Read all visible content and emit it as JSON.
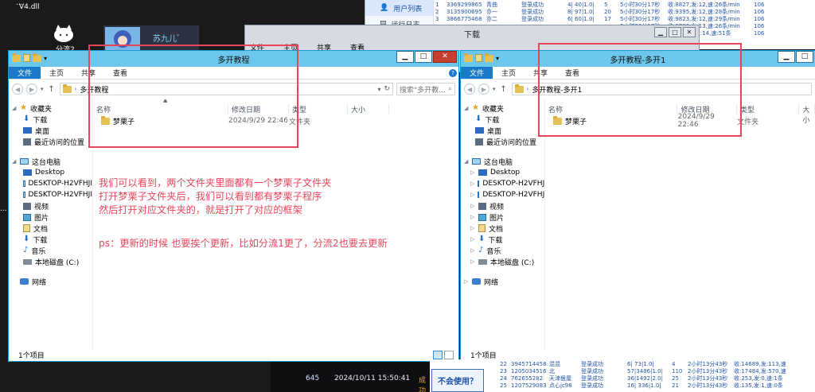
{
  "desktop": {
    "dll_label": "V4.dll",
    "top_label": "...",
    "share_label": "分流2",
    "avatar_label": "苏九儿゛",
    "left_edge_labels": [
      "..."
    ]
  },
  "bg_app": {
    "sidebar": [
      {
        "label": "用户列表",
        "active": true
      },
      {
        "label": "运行日志",
        "active": false
      }
    ],
    "rows": [
      {
        "id": "1",
        "qq": "3369299865",
        "name": "青曲",
        "status": "登录成功",
        "a": "4| 40|1.0|",
        "b": "5",
        "time": "5小时30分17秒",
        "stat": "收:8827,发:12,速:26条/min",
        "end": "106"
      },
      {
        "id": "2",
        "qq": "3135900695",
        "name": "亦一",
        "status": "登录成功",
        "a": "8| 97|1.0|",
        "b": "20",
        "time": "5小时30分17秒",
        "stat": "收:9395,发:12,速:28条/min",
        "end": "106"
      },
      {
        "id": "3",
        "qq": "3866775468",
        "name": "亦二",
        "status": "登录成功",
        "a": "6| 60|1.0|",
        "b": "17",
        "time": "5小时30分17秒",
        "stat": "收:9823,发:12,速:29条/min",
        "end": "106"
      },
      {
        "id": "",
        "qq": "",
        "name": "",
        "status": "",
        "a": "",
        "b": "",
        "time": "5小时30分17秒",
        "stat": "收:8706,发:13,速:26条/min",
        "end": "106"
      },
      {
        "id": "",
        "qq": "",
        "name": "",
        "status": "",
        "a": "",
        "b": "",
        "time": "5小时30分17秒",
        "stat": "收:17132,发:14,速:51条",
        "end": "106"
      }
    ]
  },
  "bg_bottom": {
    "help": "不会使用？",
    "rows": [
      {
        "id": "22",
        "qq": "3945714458",
        "name": "混混",
        "status": "登录成功",
        "a": "6| 73|1.0|",
        "b": "4",
        "time": "2小时13分43秒",
        "stat": "收:14689,发:113,速",
        "end": ""
      },
      {
        "id": "23",
        "qq": "1205034516",
        "name": "北",
        "status": "登录成功",
        "a": "57|3486|1.0|",
        "b": "110",
        "time": "2小时13分43秒",
        "stat": "收:17484,发:570,速",
        "end": ""
      },
      {
        "id": "24",
        "qq": "762655282",
        "name": "天津狠厘",
        "status": "登录成功",
        "a": "36|1492|2.0|",
        "b": "25",
        "time": "2小时13分43秒",
        "stat": "收:253,发:0,速:1条",
        "end": ""
      },
      {
        "id": "25",
        "qq": "1207529083",
        "name": "点心jc98",
        "status": "登录成功",
        "a": "16| 336|1.0|",
        "b": "21",
        "time": "2小时13分43秒",
        "stat": "收:135,发:1,速:0条",
        "end": ""
      }
    ]
  },
  "dark_strip": {
    "num": "645",
    "datetime": "2024/10/11 15:50:41",
    "suffix": "成功"
  },
  "download_window": {
    "title": "下载",
    "ribbon": [
      "文件",
      "主页",
      "共享",
      "查看"
    ],
    "controls": {
      "min": "▁",
      "max": "□",
      "close": "✕"
    }
  },
  "win_left": {
    "title": "多开教程",
    "ribbon": [
      "文件",
      "主页",
      "共享",
      "查看"
    ],
    "address": "多开教程",
    "search_placeholder": "搜索\"多开教...",
    "columns": [
      "名称",
      "修改日期",
      "类型",
      "大小"
    ],
    "files": [
      {
        "name": "梦栗子",
        "date": "2024/9/29 22:46",
        "type": "文件夹",
        "size": ""
      }
    ],
    "status": "1个项目",
    "controls": {
      "min": "▁",
      "max": "□",
      "close": "✕"
    }
  },
  "win_right": {
    "title": "多开教程-多开1",
    "ribbon": [
      "文件",
      "主页",
      "共享",
      "查看"
    ],
    "address": "多开教程-多开1",
    "columns": [
      "名称",
      "修改日期",
      "类型",
      "大小"
    ],
    "files": [
      {
        "name": "梦栗子",
        "date": "2024/9/29 22:46",
        "type": "文件夹",
        "size": ""
      }
    ],
    "status": "1个项目",
    "controls": {
      "min": "▁",
      "max": "□"
    }
  },
  "nav": {
    "favorites": "收藏夹",
    "fav_items": [
      "下载",
      "桌面",
      "最近访问的位置"
    ],
    "this_pc": "这台电脑",
    "pc_items": [
      "Desktop",
      "DESKTOP-H2VFHJI",
      "DESKTOP-H2VFHJI",
      "视频",
      "图片",
      "文档",
      "下载",
      "音乐",
      "本地磁盘 (C:)"
    ],
    "network": "网络"
  },
  "annotation": {
    "lines": [
      "我们可以看到，两个文件夹里面都有一个梦栗子文件夹",
      "打开梦栗子文件夹后，我们可以看到都有梦栗子程序",
      "然后打开对应文件夹的，就是打开了对应的框架"
    ],
    "ps": "ps：更新的时候  也要挨个更新，比如分流1更了，分流2也要去更新"
  },
  "colors": {
    "accent": "#1979ca",
    "title_active": "#6dc6ec",
    "annotation": "#e8455a",
    "close": "#c7402f"
  }
}
